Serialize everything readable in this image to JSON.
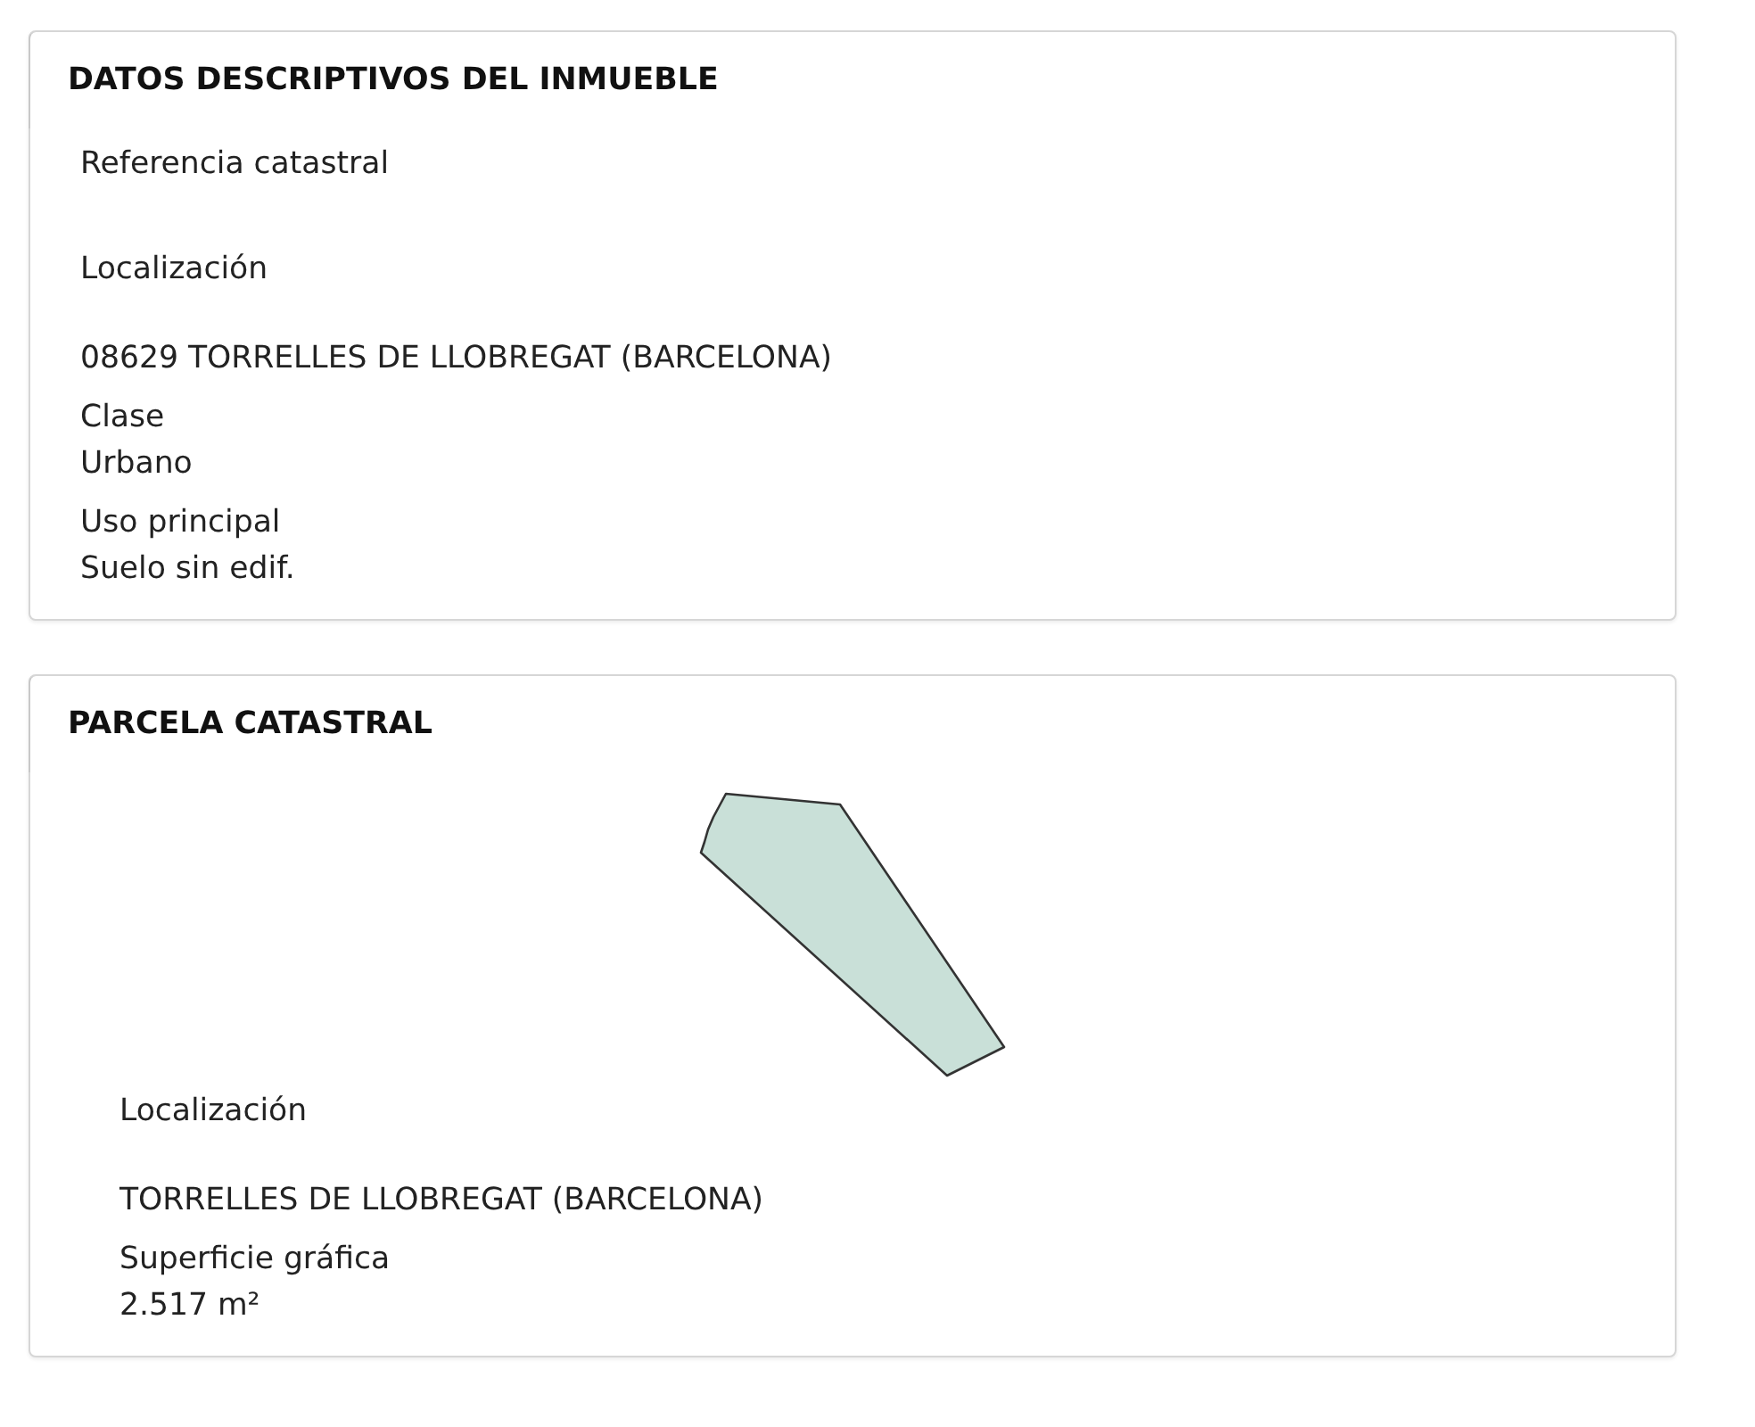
{
  "sections": [
    {
      "kind": "details",
      "title": "DATOS DESCRIPTIVOS DEL INMUEBLE",
      "fields": [
        {
          "label": "Referencia catastral"
        },
        {
          "kind": "address",
          "label": "Localización",
          "value": "08629 TORRELLES DE LLOBREGAT (BARCELONA)"
        },
        {
          "kind": "plain",
          "label": "Clase",
          "value": "Urbano"
        },
        {
          "kind": "plain",
          "label": "Uso principal",
          "value": "Suelo sin edif."
        }
      ]
    },
    {
      "kind": "parcel",
      "title": "PARCELA CATASTRAL",
      "fields": [
        {
          "kind": "address",
          "label": "Localización",
          "value": "TORRELLES DE LLOBREGAT (BARCELONA)"
        },
        {
          "kind": "plain",
          "label": "Superficie gráfica",
          "value": "2.517 m²"
        }
      ]
    }
  ]
}
